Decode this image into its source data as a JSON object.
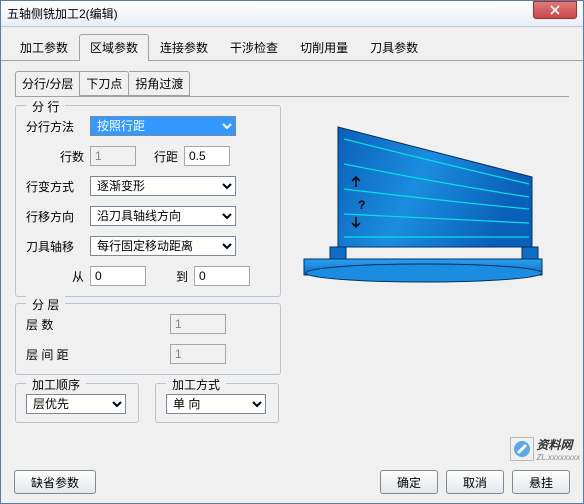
{
  "window": {
    "title": "五轴侧铣加工2(编辑)"
  },
  "tabs": {
    "main": [
      "加工参数",
      "区域参数",
      "连接参数",
      "干涉检查",
      "切削用量",
      "刀具参数"
    ],
    "active_main": 1,
    "sub": [
      "分行/分层",
      "下刀点",
      "拐角过渡"
    ],
    "active_sub": 0
  },
  "rows_group": {
    "legend": "分 行",
    "method_label": "分行方法",
    "method_value": "按照行距",
    "count_label": "行数",
    "count_value": "1",
    "pitch_label": "行距",
    "pitch_value": "0.5",
    "deform_label": "行变方式",
    "deform_value": "逐渐变形",
    "move_dir_label": "行移方向",
    "move_dir_value": "沿刀具轴线方向",
    "axis_shift_label": "刀具轴移",
    "axis_shift_value": "每行固定移动距离",
    "from_label": "从",
    "from_value": "0",
    "to_label": "到",
    "to_value": "0"
  },
  "layers_group": {
    "legend": "分 层",
    "count_label": "层    数",
    "count_value": "1",
    "gap_label": "层 间 距",
    "gap_value": "1"
  },
  "order_group": {
    "legend": "加工顺序",
    "value": "层优先"
  },
  "mode_group": {
    "legend": "加工方式",
    "value": "单 向"
  },
  "footer": {
    "defaults": "缺省参数",
    "ok": "确定",
    "cancel": "取消",
    "suspend": "悬挂"
  },
  "watermark": {
    "brand": "资料网",
    "sub": "ZL.xxxxxxxx"
  }
}
